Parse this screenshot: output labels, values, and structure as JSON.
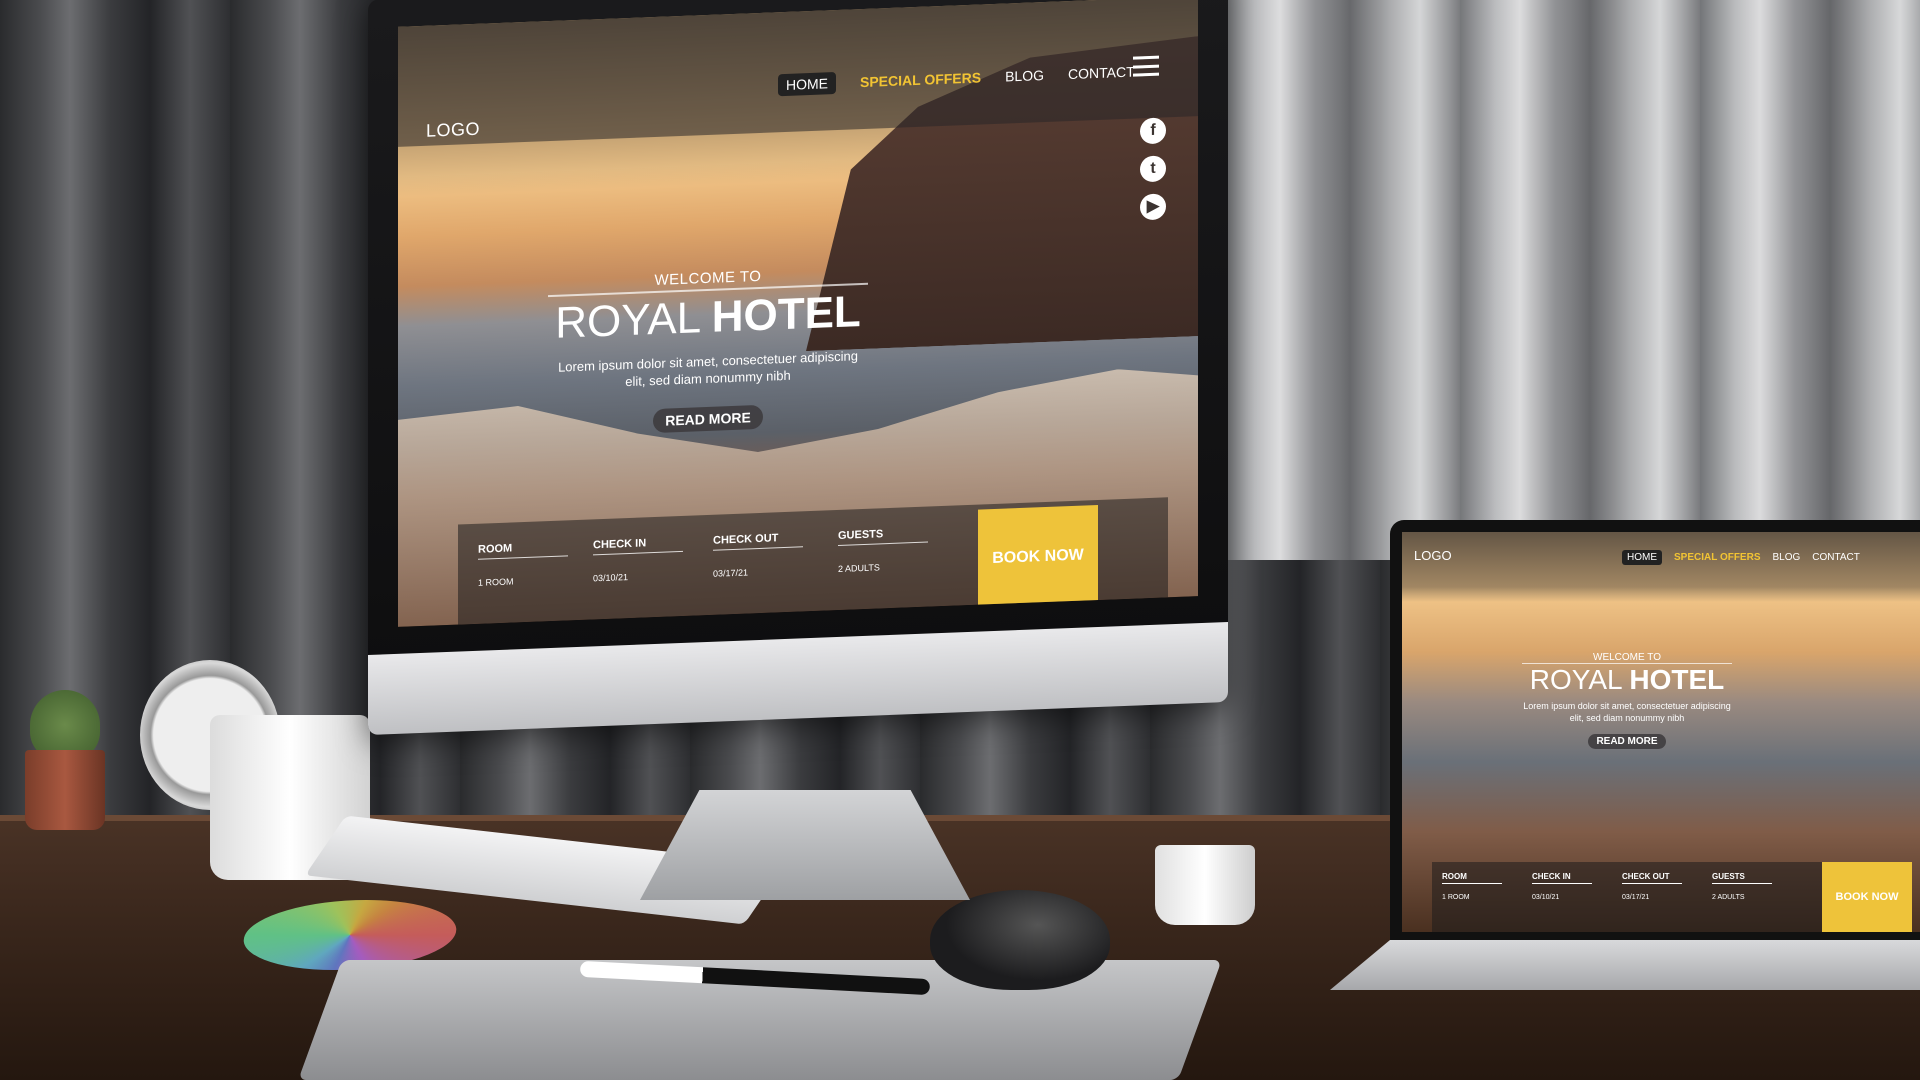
{
  "desktop_site": {
    "logo": "LOGO",
    "nav": {
      "home": "HOME",
      "special_offers": "SPECIAL OFFERS",
      "blog": "BLOG",
      "contact": "CONTACT"
    },
    "hero": {
      "welcome": "WELCOME TO",
      "title_light": "ROYAL",
      "title_bold": "HOTEL",
      "description": "Lorem ipsum dolor sit amet, consectetuer adipiscing elit, sed diam nonummy nibh",
      "read_more": "READ MORE"
    },
    "booking": {
      "room_label": "ROOM",
      "room_value": "1 ROOM",
      "checkin_label": "CHECK IN",
      "checkin_value": "03/10/21",
      "checkout_label": "CHECK OUT",
      "checkout_value": "03/17/21",
      "guests_label": "GUESTS",
      "guests_value": "2  ADULTS",
      "book_now": "BOOK NOW"
    },
    "social_icons": [
      "facebook-icon",
      "twitter-icon",
      "youtube-icon"
    ]
  },
  "laptop_site": {
    "logo": "LOGO",
    "nav": {
      "home": "HOME",
      "special_offers": "SPECIAL OFFERS",
      "blog": "BLOG",
      "contact": "CONTACT"
    },
    "hero": {
      "welcome": "WELCOME TO",
      "title_light": "ROYAL",
      "title_bold": "HOTEL",
      "description": "Lorem ipsum dolor sit amet, consectetuer adipiscing elit, sed diam nonummy nibh",
      "read_more": "READ MORE"
    },
    "booking": {
      "room_label": "ROOM",
      "room_value": "1 ROOM",
      "checkin_label": "CHECK IN",
      "checkin_value": "03/10/21",
      "checkout_label": "CHECK OUT",
      "checkout_value": "03/17/21",
      "guests_label": "GUESTS",
      "guests_value": "2  ADULTS",
      "book_now": "BOOK NOW"
    }
  },
  "colors": {
    "accent_yellow": "#eec33a",
    "offers_yellow": "#f2c433"
  }
}
